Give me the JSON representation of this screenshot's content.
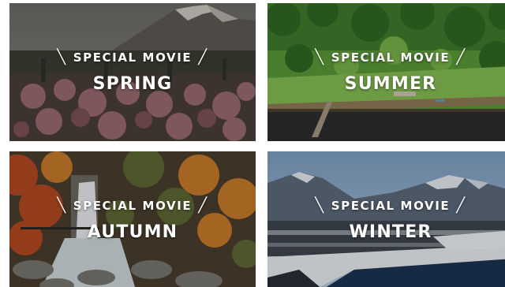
{
  "tiles": [
    {
      "kicker": "SPECIAL MOVIE",
      "season": "SPRING"
    },
    {
      "kicker": "SPECIAL MOVIE",
      "season": "SUMMER"
    },
    {
      "kicker": "SPECIAL MOVIE",
      "season": "AUTUMN"
    },
    {
      "kicker": "SPECIAL MOVIE",
      "season": "WINTER"
    }
  ],
  "slash_left": "╲",
  "slash_right": "╱",
  "colors": {
    "caption_text": "#ffffff",
    "background": "#ffffff"
  }
}
